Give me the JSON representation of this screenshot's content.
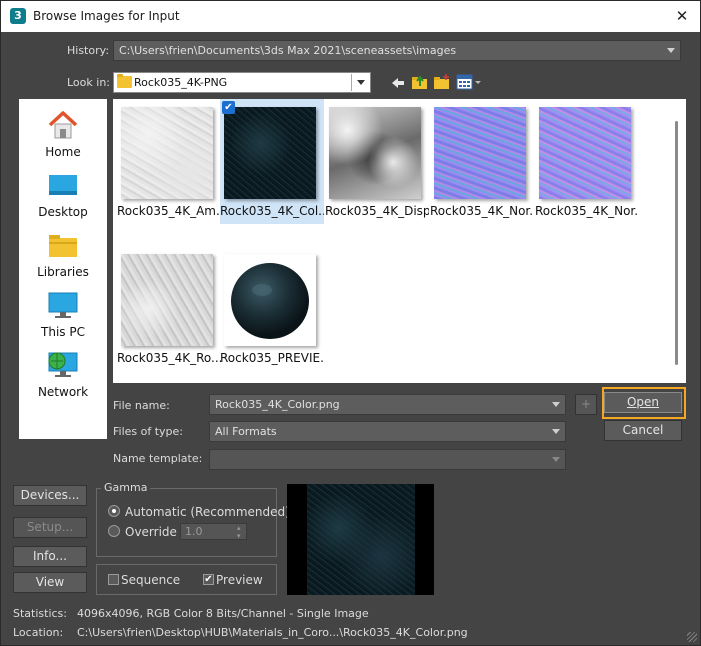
{
  "window": {
    "title": "Browse Images for Input",
    "app_badge": "3",
    "close_glyph": "✕"
  },
  "history": {
    "label": "History:",
    "value": "C:\\Users\\frien\\Documents\\3ds Max 2021\\sceneassets\\images"
  },
  "look_in": {
    "label": "Look in:",
    "value": "Rock035_4K-PNG"
  },
  "toolbar": {
    "icons": [
      "back-arrow-icon",
      "up-folder-icon",
      "new-folder-icon",
      "view-menu-icon"
    ]
  },
  "places": [
    {
      "label": "Home",
      "icon": "home-icon"
    },
    {
      "label": "Desktop",
      "icon": "desktop-icon"
    },
    {
      "label": "Libraries",
      "icon": "libraries-icon"
    },
    {
      "label": "This PC",
      "icon": "this-pc-icon"
    },
    {
      "label": "Network",
      "icon": "network-icon"
    }
  ],
  "files": [
    {
      "caption": "Rock035_4K_Am...",
      "selected": false
    },
    {
      "caption": "Rock035_4K_Col...",
      "selected": true
    },
    {
      "caption": "Rock035_4K_Disp...",
      "selected": false
    },
    {
      "caption": "Rock035_4K_Nor...",
      "selected": false
    },
    {
      "caption": "Rock035_4K_Nor...",
      "selected": false
    },
    {
      "caption": "Rock035_4K_Ro...",
      "selected": false
    },
    {
      "caption": "Rock035_PREVIE...",
      "selected": false
    }
  ],
  "file_name": {
    "label": "File name:",
    "value": "Rock035_4K_Color.png",
    "add_glyph": "+"
  },
  "files_of_type": {
    "label": "Files of type:",
    "value": "All Formats"
  },
  "name_template": {
    "label": "Name template:",
    "value": ""
  },
  "buttons": {
    "open": "Open",
    "cancel": "Cancel",
    "devices": "Devices...",
    "setup": "Setup...",
    "info": "Info...",
    "view": "View"
  },
  "gamma": {
    "title": "Gamma",
    "automatic": "Automatic (Recommended)",
    "override": "Override",
    "override_value": "1.0",
    "selected": "automatic"
  },
  "options": {
    "sequence": "Sequence",
    "sequence_checked": false,
    "preview": "Preview",
    "preview_checked": true,
    "check_glyph": "✔"
  },
  "statistics": {
    "label": "Statistics:",
    "value": "4096x4096, RGB Color 8 Bits/Channel - Single Image"
  },
  "location": {
    "label": "Location:",
    "value": "C:\\Users\\frien\\Desktop\\HUB\\Materials_in_Coro...\\Rock035_4K_Color.png"
  },
  "colors": {
    "accent": "#f5a623",
    "selection": "#cfe4f7",
    "dialog_bg": "#444444"
  }
}
